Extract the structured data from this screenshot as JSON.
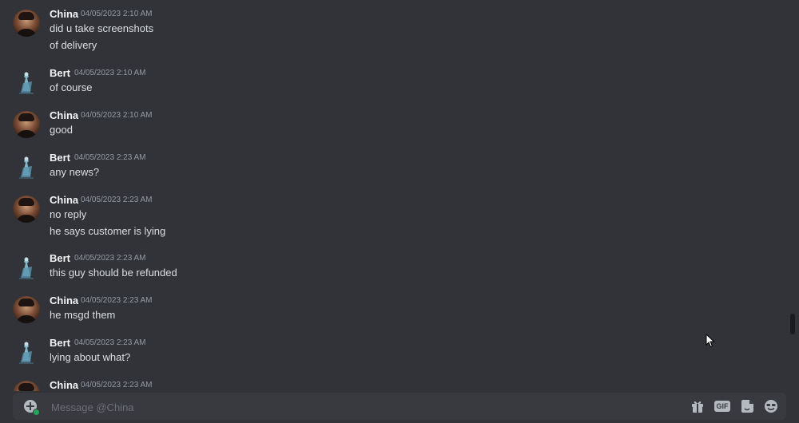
{
  "messages": [
    {
      "author": "China",
      "avatar": "china",
      "time": "04/05/2023 2:10 AM",
      "lines": [
        "did u take screenshots",
        "of delivery"
      ]
    },
    {
      "author": "Bert",
      "avatar": "bert",
      "time": "04/05/2023 2:10 AM",
      "lines": [
        "of course"
      ]
    },
    {
      "author": "China",
      "avatar": "china",
      "time": "04/05/2023 2:10 AM",
      "lines": [
        "good"
      ]
    },
    {
      "author": "Bert",
      "avatar": "bert",
      "time": "04/05/2023 2:23 AM",
      "lines": [
        "any news?"
      ]
    },
    {
      "author": "China",
      "avatar": "china",
      "time": "04/05/2023 2:23 AM",
      "lines": [
        "no reply",
        "he says customer is lying"
      ]
    },
    {
      "author": "Bert",
      "avatar": "bert",
      "time": "04/05/2023 2:23 AM",
      "lines": [
        "this guy should be refunded"
      ]
    },
    {
      "author": "China",
      "avatar": "china",
      "time": "04/05/2023 2:23 AM",
      "lines": [
        "he msgd them"
      ]
    },
    {
      "author": "Bert",
      "avatar": "bert",
      "time": "04/05/2023 2:23 AM",
      "lines": [
        "lying about what?"
      ]
    },
    {
      "author": "China",
      "avatar": "china",
      "time": "04/05/2023 2:23 AM",
      "lines": []
    }
  ],
  "composer": {
    "placeholder": "Message @China",
    "gif_label": "GIF",
    "icons": [
      "add-attachment-icon",
      "gift-icon",
      "gif-icon",
      "sticker-icon",
      "emoji-icon"
    ]
  },
  "colors": {
    "background": "#313338",
    "composer": "#383a40",
    "username": "#f2f3f5",
    "message_text": "#dbdee1",
    "timestamp": "#949ba4"
  }
}
